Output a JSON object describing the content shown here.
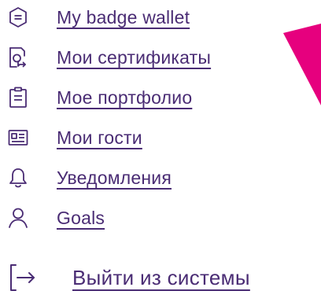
{
  "menu": {
    "items": [
      {
        "label": "My badge wallet",
        "icon": "badge-wallet-icon"
      },
      {
        "label": "Мои сертификаты",
        "icon": "certificate-icon"
      },
      {
        "label": "Мое портфолио",
        "icon": "clipboard-icon"
      },
      {
        "label": "Мои гости",
        "icon": "guest-card-icon"
      },
      {
        "label": "Уведомления",
        "icon": "bell-icon"
      },
      {
        "label": "Goals",
        "icon": "user-icon"
      }
    ],
    "logout": {
      "label": "Выйти из системы",
      "icon": "logout-icon"
    }
  },
  "colors": {
    "text": "#4a2c74",
    "icon": "#4a2c74",
    "accent": "#e6007e"
  }
}
